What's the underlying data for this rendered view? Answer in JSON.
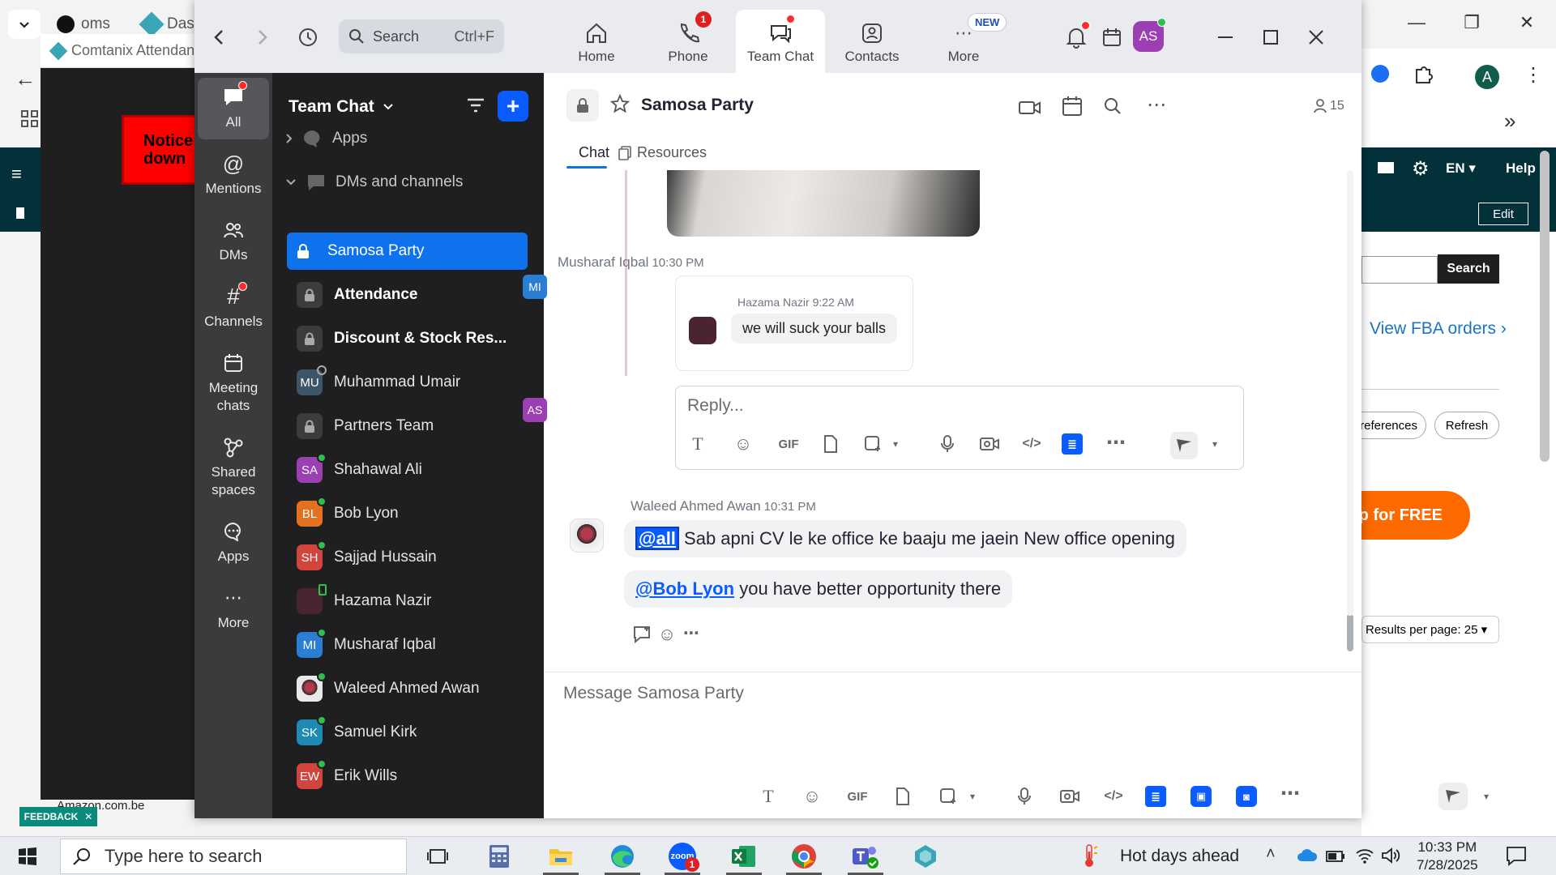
{
  "bg": {
    "tab1": "oms",
    "tab2": "Das",
    "popup_title": "Comtanix Attendance",
    "notice": "Notice: down",
    "amazon_line": "Amazon.com.be",
    "right_email": "EN",
    "right_help": "Help",
    "edit": "Edit",
    "search_btn": "Search",
    "fba": "View FBA orders",
    "preferences": "references",
    "refresh": "Refresh",
    "signup": "up for FREE",
    "results": "Results per page: 25",
    "feedback": "FEEDBACK"
  },
  "titlebar": {
    "search_placeholder": "Search",
    "search_shortcut": "Ctrl+F",
    "nav": [
      {
        "label": "Home"
      },
      {
        "label": "Phone",
        "badge": "1"
      },
      {
        "label": "Team Chat"
      },
      {
        "label": "Contacts"
      },
      {
        "label": "More",
        "badge": "NEW"
      }
    ],
    "avatar": "AS"
  },
  "rail": [
    {
      "label": "All"
    },
    {
      "label": "Mentions"
    },
    {
      "label": "DMs"
    },
    {
      "label": "Channels"
    },
    {
      "label": "Meeting chats"
    },
    {
      "label": "Shared spaces"
    },
    {
      "label": "Apps"
    },
    {
      "label": "More"
    }
  ],
  "sidebar": {
    "title": "Team Chat",
    "sections": {
      "apps": "Apps",
      "dms": "DMs and channels"
    },
    "items": [
      {
        "label": "Samosa Party"
      },
      {
        "label": "Attendance"
      },
      {
        "label": "Discount & Stock Res..."
      },
      {
        "label": "Muhammad Umair",
        "initials": "MU"
      },
      {
        "label": "Partners Team"
      },
      {
        "label": "Shahawal Ali",
        "initials": "SA"
      },
      {
        "label": "Bob Lyon",
        "initials": "BL"
      },
      {
        "label": "Sajjad Hussain",
        "initials": "SH"
      },
      {
        "label": "Hazama Nazir"
      },
      {
        "label": "Musharaf Iqbal",
        "initials": "MI"
      },
      {
        "label": "Waleed Ahmed Awan"
      },
      {
        "label": "Samuel Kirk",
        "initials": "SK"
      },
      {
        "label": "Erik Wills",
        "initials": "EW"
      }
    ]
  },
  "chat": {
    "name": "Samosa Party",
    "members": "15",
    "tabs": {
      "chat": "Chat",
      "resources": "Resources"
    },
    "messages": {
      "m1_sender": "Musharaf Iqbal",
      "m1_time": "10:30 PM",
      "m1_initials": "MI",
      "quote_sender": "Hazama Nazir",
      "quote_time": "9:22 AM",
      "quote_text": "we will suck your balls",
      "reply_initials": "AS",
      "reply_placeholder": "Reply...",
      "m2_sender": "Waleed Ahmed Awan",
      "m2_time": "10:31 PM",
      "m2_mention": "@all",
      "m2_text": "Sab apni CV le ke office ke baaju me jaein New office opening",
      "m3_mention": "@Bob Lyon",
      "m3_text": "you have better opportunity there"
    },
    "compose_placeholder": "Message Samosa Party",
    "gif": "GIF"
  },
  "taskbar": {
    "search_placeholder": "Type here to search",
    "weather": "Hot days ahead",
    "time": "10:33 PM",
    "date": "7/28/2025",
    "zoom_badge": "1"
  },
  "colors": {
    "zoom_blue": "#0e72ed",
    "rail_bg": "#3b3b3e",
    "sidebar_bg": "#1f1f21",
    "presence_green": "#2fbf4b",
    "badge_red": "#e02020"
  }
}
